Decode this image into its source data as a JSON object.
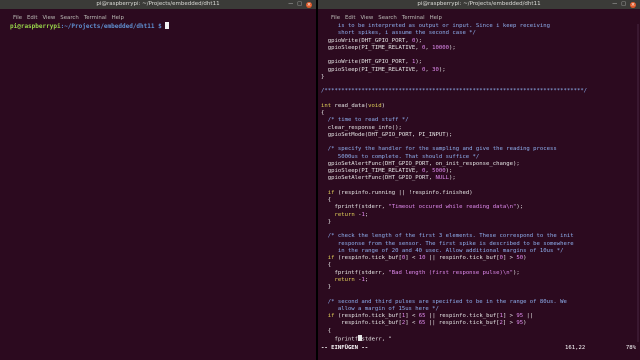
{
  "left_terminal": {
    "title": "pi@raspberrypi: ~/Projects/embedded/dht11",
    "menu": [
      "File",
      "Edit",
      "View",
      "Search",
      "Terminal",
      "Help"
    ],
    "prompt_user": "pi@raspberrypi",
    "prompt_path": ":~/Projects/embedded/dht11 $ "
  },
  "right_terminal": {
    "title": "pi@raspberrypi: ~/Projects/embedded/dht11",
    "menu": [
      "File",
      "Edit",
      "View",
      "Search",
      "Terminal",
      "Help"
    ],
    "code_lines": [
      [
        [
          "cm",
          "     is to be interpreted as output or input. Since i keep receiving"
        ]
      ],
      [
        [
          "cm",
          "     short spikes, i assume the second case */"
        ]
      ],
      [
        [
          "t",
          "  gpioWrite(DHT_GPIO_PORT, "
        ],
        [
          "nm",
          "0"
        ],
        [
          "t",
          ");"
        ]
      ],
      [
        [
          "t",
          "  gpioSleep(PI_TIME_RELATIVE, "
        ],
        [
          "nm",
          "0"
        ],
        [
          "t",
          ", "
        ],
        [
          "nm",
          "10000"
        ],
        [
          "t",
          ");"
        ]
      ],
      [
        [
          "t",
          ""
        ]
      ],
      [
        [
          "t",
          "  gpioWrite(DHT_GPIO_PORT, "
        ],
        [
          "nm",
          "1"
        ],
        [
          "t",
          ");"
        ]
      ],
      [
        [
          "t",
          "  gpioSleep(PI_TIME_RELATIVE, "
        ],
        [
          "nm",
          "0"
        ],
        [
          "t",
          ", "
        ],
        [
          "nm",
          "30"
        ],
        [
          "t",
          ");"
        ]
      ],
      [
        [
          "t",
          "}"
        ]
      ],
      [
        [
          "t",
          ""
        ]
      ],
      [
        [
          "cm",
          "/*****************************************************************************/"
        ]
      ],
      [
        [
          "t",
          ""
        ]
      ],
      [
        [
          "kw",
          "int"
        ],
        [
          "t",
          " read_data("
        ],
        [
          "kw",
          "void"
        ],
        [
          "t",
          ")"
        ]
      ],
      [
        [
          "t",
          "{"
        ]
      ],
      [
        [
          "cm",
          "  /* time to read stuff */"
        ]
      ],
      [
        [
          "t",
          "  clear_response_info();"
        ]
      ],
      [
        [
          "t",
          "  gpioSetMode(DHT_GPIO_PORT, PI_INPUT);"
        ]
      ],
      [
        [
          "t",
          ""
        ]
      ],
      [
        [
          "cm",
          "  /* specify the handler for the sampling and give the reading process"
        ]
      ],
      [
        [
          "cm",
          "     5000us to complete. That should suffice */"
        ]
      ],
      [
        [
          "t",
          "  gpioSetAlertFunc(DHT_GPIO_PORT, on_init_response_change);"
        ]
      ],
      [
        [
          "t",
          "  gpioSleep(PI_TIME_RELATIVE, "
        ],
        [
          "nm",
          "0"
        ],
        [
          "t",
          ", "
        ],
        [
          "nm",
          "5000"
        ],
        [
          "t",
          ");"
        ]
      ],
      [
        [
          "t",
          "  gpioSetAlertFunc(DHT_GPIO_PORT, "
        ],
        [
          "nm",
          "NULL"
        ],
        [
          "t",
          ");"
        ]
      ],
      [
        [
          "t",
          ""
        ]
      ],
      [
        [
          "t",
          "  "
        ],
        [
          "kw",
          "if"
        ],
        [
          "t",
          " (respinfo.running || !respinfo.finished)"
        ]
      ],
      [
        [
          "t",
          "  {"
        ]
      ],
      [
        [
          "t",
          "    fprintf(stderr, "
        ],
        [
          "st",
          "\"Timeout occured while reading data\\n\""
        ],
        [
          "t",
          ");"
        ]
      ],
      [
        [
          "t",
          "    "
        ],
        [
          "kw",
          "return"
        ],
        [
          "t",
          " -"
        ],
        [
          "nm",
          "1"
        ],
        [
          "t",
          ";"
        ]
      ],
      [
        [
          "t",
          "  }"
        ]
      ],
      [
        [
          "t",
          ""
        ]
      ],
      [
        [
          "cm",
          "  /* check the length of the first 3 elements. These correspond to the init"
        ]
      ],
      [
        [
          "cm",
          "     response from the sensor. The first spike is described to be somewhere"
        ]
      ],
      [
        [
          "cm",
          "     in the range of 20 and 40 usec. Allow additional margins of 10us */"
        ]
      ],
      [
        [
          "t",
          "  "
        ],
        [
          "kw",
          "if"
        ],
        [
          "t",
          " (respinfo.tick_buf["
        ],
        [
          "nm",
          "0"
        ],
        [
          "t",
          "] < "
        ],
        [
          "nm",
          "10"
        ],
        [
          "t",
          " || respinfo.tick_buf["
        ],
        [
          "nm",
          "0"
        ],
        [
          "t",
          "] > "
        ],
        [
          "nm",
          "50"
        ],
        [
          "t",
          ")"
        ]
      ],
      [
        [
          "t",
          "  {"
        ]
      ],
      [
        [
          "t",
          "    fprintf(stderr, "
        ],
        [
          "st",
          "\"Bad length (first response pulse)\\n\""
        ],
        [
          "t",
          ");"
        ]
      ],
      [
        [
          "t",
          "    "
        ],
        [
          "kw",
          "return"
        ],
        [
          "t",
          " -"
        ],
        [
          "nm",
          "1"
        ],
        [
          "t",
          ";"
        ]
      ],
      [
        [
          "t",
          "  }"
        ]
      ],
      [
        [
          "t",
          ""
        ]
      ],
      [
        [
          "cm",
          "  /* second and third pulses are specified to be in the range of 80us. We"
        ]
      ],
      [
        [
          "cm",
          "     allow a margin of 15us here */"
        ]
      ],
      [
        [
          "t",
          "  "
        ],
        [
          "kw",
          "if"
        ],
        [
          "t",
          " (respinfo.tick_buf["
        ],
        [
          "nm",
          "1"
        ],
        [
          "t",
          "] < "
        ],
        [
          "nm",
          "65"
        ],
        [
          "t",
          " || respinfo.tick_buf["
        ],
        [
          "nm",
          "1"
        ],
        [
          "t",
          "] > "
        ],
        [
          "nm",
          "95"
        ],
        [
          "t",
          " ||"
        ]
      ],
      [
        [
          "t",
          "      respinfo.tick_buf["
        ],
        [
          "nm",
          "2"
        ],
        [
          "t",
          "] < "
        ],
        [
          "nm",
          "65"
        ],
        [
          "t",
          " || respinfo.tick_buf["
        ],
        [
          "nm",
          "2"
        ],
        [
          "t",
          "] > "
        ],
        [
          "nm",
          "95"
        ],
        [
          "t",
          ")"
        ]
      ],
      [
        [
          "t",
          "  {"
        ]
      ],
      [
        [
          "t",
          "    fprintf"
        ],
        [
          "cur",
          ""
        ],
        [
          "t",
          "stderr, \""
        ]
      ]
    ],
    "status_mode": "-- EINFÜGEN --",
    "status_position": "161,22",
    "status_percent": "78%"
  }
}
